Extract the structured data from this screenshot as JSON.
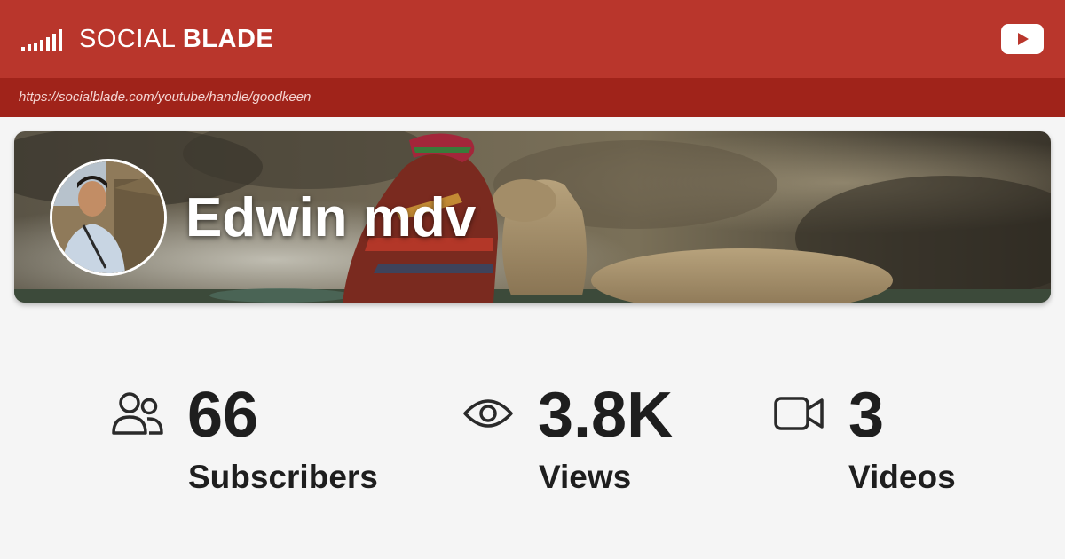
{
  "header": {
    "brand_light": "SOCIAL",
    "brand_bold": "BLADE",
    "logo_icon": "signal-bars-icon",
    "youtube_icon": "youtube-play-icon",
    "accent_color": "#b9362c",
    "url_bar_color": "#a0231a"
  },
  "url": {
    "text": "https://socialblade.com/youtube/handle/goodkeen"
  },
  "channel": {
    "name": "Edwin mdv",
    "avatar_icon": "channel-avatar",
    "banner_icon": "channel-banner-image"
  },
  "stats": [
    {
      "icon": "users-icon",
      "value": "66",
      "label": "Subscribers"
    },
    {
      "icon": "eye-icon",
      "value": "3.8K",
      "label": "Views"
    },
    {
      "icon": "video-camera-icon",
      "value": "3",
      "label": "Videos"
    }
  ]
}
